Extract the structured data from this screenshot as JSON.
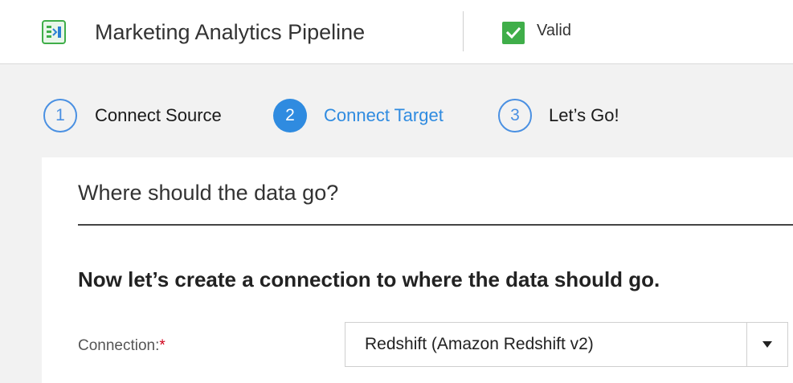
{
  "header": {
    "app_icon": "pipeline-app-icon",
    "title": "Marketing Analytics Pipeline",
    "status": {
      "icon": "checkmark-icon",
      "label": "Valid",
      "color": "#3fae49"
    }
  },
  "steps": [
    {
      "number": "1",
      "label": "Connect Source",
      "state": "complete"
    },
    {
      "number": "2",
      "label": "Connect Target",
      "state": "active"
    },
    {
      "number": "3",
      "label": "Let’s Go!",
      "state": "upcoming"
    }
  ],
  "card": {
    "title": "Where should the data go?",
    "subtitle": "Now let’s create a connection to where the data should go.",
    "connection": {
      "label": "Connection:",
      "required_marker": "*",
      "value": "Redshift (Amazon Redshift v2)",
      "caret_icon": "caret-down-icon"
    }
  },
  "colors": {
    "accent": "#2f8be0",
    "valid_green": "#3fae49",
    "required_red": "#d0021b",
    "background_grey": "#f2f2f2"
  }
}
